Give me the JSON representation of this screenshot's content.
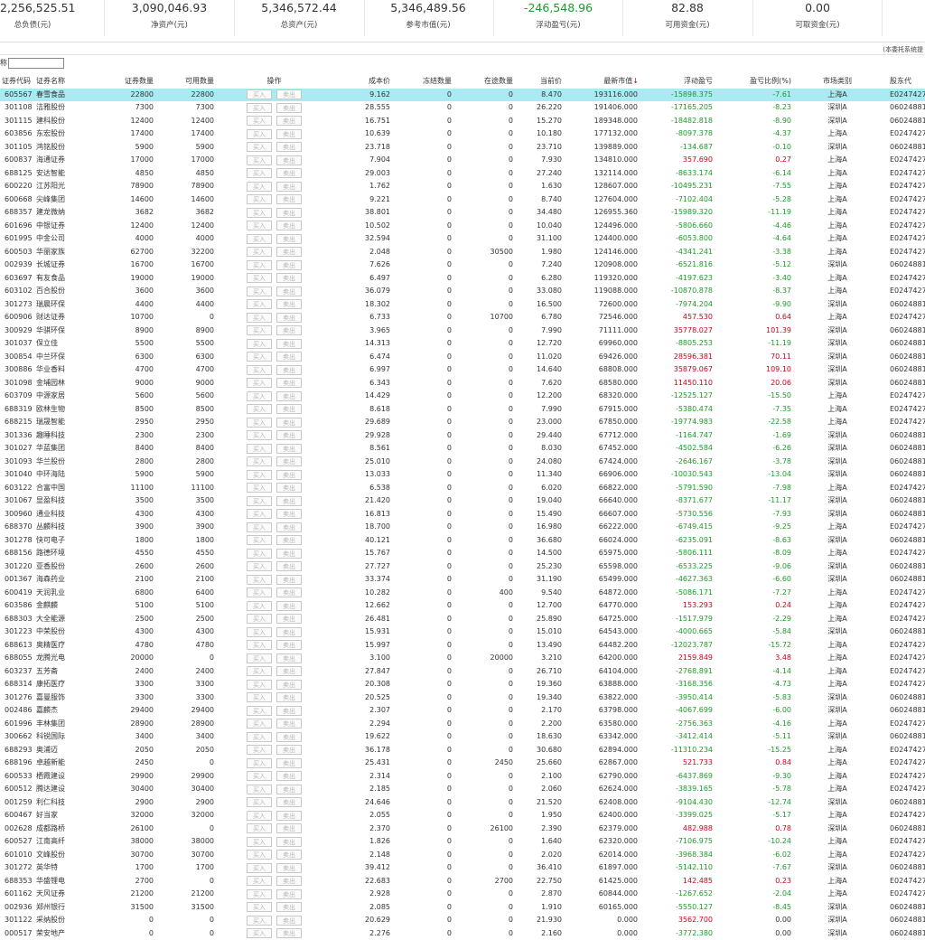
{
  "summary": [
    {
      "value": "2,256,525.51",
      "label": "总负债(元)"
    },
    {
      "value": "3,090,046.93",
      "label": "净资产(元)"
    },
    {
      "value": "5,346,572.44",
      "label": "总资产(元)"
    },
    {
      "value": "5,346,489.56",
      "label": "参考市值(元)"
    },
    {
      "value": "-246,548.96",
      "label": "浮动盈亏(元)",
      "color": "#1c9c28"
    },
    {
      "value": "82.88",
      "label": "可用资金(元)"
    },
    {
      "value": "0.00",
      "label": "可取资金(元)"
    }
  ],
  "note": "(本委托系统提",
  "filter_label": "称",
  "filter_value": "",
  "buy_label": "买入",
  "sell_label": "卖出",
  "sort_icon": "↓",
  "columns": [
    "证券代码",
    "证券名称",
    "证券数量",
    "可用数量",
    "操作",
    "成本价",
    "冻结数量",
    "在途数量",
    "当前价",
    "最新市值",
    "浮动盈亏",
    "盈亏比例(%)",
    "市场类别",
    "股东代"
  ],
  "rows": [
    [
      "605567",
      "春雪食品",
      "22800",
      "22800",
      "9.162",
      "0",
      "0",
      "8.470",
      "193116.000",
      "-15898.375",
      "-7.61",
      "上海A",
      "E0247427"
    ],
    [
      "301108",
      "洁雅股份",
      "7300",
      "7300",
      "28.555",
      "0",
      "0",
      "26.220",
      "191406.000",
      "-17165.205",
      "-8.23",
      "深圳A",
      "06024881"
    ],
    [
      "301115",
      "建科股份",
      "12400",
      "12400",
      "16.751",
      "0",
      "0",
      "15.270",
      "189348.000",
      "-18482.818",
      "-8.90",
      "深圳A",
      "06024881"
    ],
    [
      "603856",
      "东宏股份",
      "17400",
      "17400",
      "10.639",
      "0",
      "0",
      "10.180",
      "177132.000",
      "-8097.378",
      "-4.37",
      "上海A",
      "E0247427"
    ],
    [
      "301105",
      "鸿铭股份",
      "5900",
      "5900",
      "23.718",
      "0",
      "0",
      "23.710",
      "139889.000",
      "-134.687",
      "-0.10",
      "深圳A",
      "06024881"
    ],
    [
      "600837",
      "海通证券",
      "17000",
      "17000",
      "7.904",
      "0",
      "0",
      "7.930",
      "134810.000",
      "357.690",
      "0.27",
      "上海A",
      "E0247427"
    ],
    [
      "688125",
      "安达智能",
      "4850",
      "4850",
      "29.003",
      "0",
      "0",
      "27.240",
      "132114.000",
      "-8633.174",
      "-6.14",
      "上海A",
      "E0247427"
    ],
    [
      "600220",
      "江苏阳光",
      "78900",
      "78900",
      "1.762",
      "0",
      "0",
      "1.630",
      "128607.000",
      "-10495.231",
      "-7.55",
      "上海A",
      "E0247427"
    ],
    [
      "600668",
      "尖峰集团",
      "14600",
      "14600",
      "9.221",
      "0",
      "0",
      "8.740",
      "127604.000",
      "-7102.404",
      "-5.28",
      "上海A",
      "E0247427"
    ],
    [
      "688357",
      "建龙微纳",
      "3682",
      "3682",
      "38.801",
      "0",
      "0",
      "34.480",
      "126955.360",
      "-15989.320",
      "-11.19",
      "上海A",
      "E0247427"
    ],
    [
      "601696",
      "中银证券",
      "12400",
      "12400",
      "10.502",
      "0",
      "0",
      "10.040",
      "124496.000",
      "-5806.660",
      "-4.46",
      "上海A",
      "E0247427"
    ],
    [
      "601995",
      "中金公司",
      "4000",
      "4000",
      "32.594",
      "0",
      "0",
      "31.100",
      "124400.000",
      "-6053.800",
      "-4.64",
      "上海A",
      "E0247427"
    ],
    [
      "600503",
      "华丽家族",
      "62700",
      "32200",
      "2.048",
      "0",
      "30500",
      "1.980",
      "124146.000",
      "-4341.241",
      "-3.38",
      "上海A",
      "E0247427"
    ],
    [
      "002939",
      "长城证券",
      "16700",
      "16700",
      "7.626",
      "0",
      "0",
      "7.240",
      "120908.000",
      "-6521.816",
      "-5.12",
      "深圳A",
      "06024881"
    ],
    [
      "603697",
      "有友食品",
      "19000",
      "19000",
      "6.497",
      "0",
      "0",
      "6.280",
      "119320.000",
      "-4197.623",
      "-3.40",
      "上海A",
      "E0247427"
    ],
    [
      "603102",
      "百合股份",
      "3600",
      "3600",
      "36.079",
      "0",
      "0",
      "33.080",
      "119088.000",
      "-10870.878",
      "-8.37",
      "上海A",
      "E0247427"
    ],
    [
      "301273",
      "瑞晨环保",
      "4400",
      "4400",
      "18.302",
      "0",
      "0",
      "16.500",
      "72600.000",
      "-7974.204",
      "-9.90",
      "深圳A",
      "06024881"
    ],
    [
      "600906",
      "财达证券",
      "10700",
      "0",
      "6.733",
      "0",
      "10700",
      "6.780",
      "72546.000",
      "457.530",
      "0.64",
      "上海A",
      "E0247427"
    ],
    [
      "300929",
      "华骐环保",
      "8900",
      "8900",
      "3.965",
      "0",
      "0",
      "7.990",
      "71111.000",
      "35778.027",
      "101.39",
      "深圳A",
      "06024881"
    ],
    [
      "301037",
      "保立佳",
      "5500",
      "5500",
      "14.313",
      "0",
      "0",
      "12.720",
      "69960.000",
      "-8805.253",
      "-11.19",
      "深圳A",
      "06024881"
    ],
    [
      "300854",
      "中兰环保",
      "6300",
      "6300",
      "6.474",
      "0",
      "0",
      "11.020",
      "69426.000",
      "28596.381",
      "70.11",
      "深圳A",
      "06024881"
    ],
    [
      "300886",
      "华业香料",
      "4700",
      "4700",
      "6.997",
      "0",
      "0",
      "14.640",
      "68808.000",
      "35879.067",
      "109.10",
      "深圳A",
      "06024881"
    ],
    [
      "301098",
      "金埔园林",
      "9000",
      "9000",
      "6.343",
      "0",
      "0",
      "7.620",
      "68580.000",
      "11450.110",
      "20.06",
      "深圳A",
      "06024881"
    ],
    [
      "603709",
      "中源家居",
      "5600",
      "5600",
      "14.429",
      "0",
      "0",
      "12.200",
      "68320.000",
      "-12525.127",
      "-15.50",
      "上海A",
      "E0247427"
    ],
    [
      "688319",
      "欧林生物",
      "8500",
      "8500",
      "8.618",
      "0",
      "0",
      "7.990",
      "67915.000",
      "-5380.474",
      "-7.35",
      "上海A",
      "E0247427"
    ],
    [
      "688215",
      "瑞晟智能",
      "2950",
      "2950",
      "29.689",
      "0",
      "0",
      "23.000",
      "67850.000",
      "-19774.983",
      "-22.58",
      "上海A",
      "E0247427"
    ],
    [
      "301336",
      "趣睡科技",
      "2300",
      "2300",
      "29.928",
      "0",
      "0",
      "29.440",
      "67712.000",
      "-1164.747",
      "-1.69",
      "深圳A",
      "06024881"
    ],
    [
      "301027",
      "华蓝集团",
      "8400",
      "8400",
      "8.561",
      "0",
      "0",
      "8.030",
      "67452.000",
      "-4502.584",
      "-6.26",
      "深圳A",
      "06024881"
    ],
    [
      "301093",
      "华兰股份",
      "2800",
      "2800",
      "25.010",
      "0",
      "0",
      "24.080",
      "67424.000",
      "-2646.167",
      "-3.78",
      "深圳A",
      "06024881"
    ],
    [
      "301040",
      "中环海陆",
      "5900",
      "5900",
      "13.033",
      "0",
      "0",
      "11.340",
      "66906.000",
      "-10030.543",
      "-13.04",
      "深圳A",
      "06024881"
    ],
    [
      "603122",
      "合富中国",
      "11100",
      "11100",
      "6.538",
      "0",
      "0",
      "6.020",
      "66822.000",
      "-5791.590",
      "-7.98",
      "上海A",
      "E0247427"
    ],
    [
      "301067",
      "显盈科技",
      "3500",
      "3500",
      "21.420",
      "0",
      "0",
      "19.040",
      "66640.000",
      "-8371.677",
      "-11.17",
      "深圳A",
      "06024881"
    ],
    [
      "300960",
      "通业科技",
      "4300",
      "4300",
      "16.813",
      "0",
      "0",
      "15.490",
      "66607.000",
      "-5730.556",
      "-7.93",
      "深圳A",
      "06024881"
    ],
    [
      "688370",
      "丛麟科技",
      "3900",
      "3900",
      "18.700",
      "0",
      "0",
      "16.980",
      "66222.000",
      "-6749.415",
      "-9.25",
      "上海A",
      "E0247427"
    ],
    [
      "301278",
      "快可电子",
      "1800",
      "1800",
      "40.121",
      "0",
      "0",
      "36.680",
      "66024.000",
      "-6235.091",
      "-8.63",
      "深圳A",
      "06024881"
    ],
    [
      "688156",
      "路德环境",
      "4550",
      "4550",
      "15.767",
      "0",
      "0",
      "14.500",
      "65975.000",
      "-5806.111",
      "-8.09",
      "上海A",
      "E0247427"
    ],
    [
      "301220",
      "亚香股份",
      "2600",
      "2600",
      "27.727",
      "0",
      "0",
      "25.230",
      "65598.000",
      "-6533.225",
      "-9.06",
      "深圳A",
      "06024881"
    ],
    [
      "001367",
      "海森药业",
      "2100",
      "2100",
      "33.374",
      "0",
      "0",
      "31.190",
      "65499.000",
      "-4627.363",
      "-6.60",
      "深圳A",
      "06024881"
    ],
    [
      "600419",
      "天润乳业",
      "6800",
      "6400",
      "10.282",
      "0",
      "400",
      "9.540",
      "64872.000",
      "-5086.171",
      "-7.27",
      "上海A",
      "E0247427"
    ],
    [
      "603586",
      "金麒麟",
      "5100",
      "5100",
      "12.662",
      "0",
      "0",
      "12.700",
      "64770.000",
      "153.293",
      "0.24",
      "上海A",
      "E0247427"
    ],
    [
      "688303",
      "大全能源",
      "2500",
      "2500",
      "26.481",
      "0",
      "0",
      "25.890",
      "64725.000",
      "-1517.979",
      "-2.29",
      "上海A",
      "E0247427"
    ],
    [
      "301223",
      "中荣股份",
      "4300",
      "4300",
      "15.931",
      "0",
      "0",
      "15.010",
      "64543.000",
      "-4000.665",
      "-5.84",
      "深圳A",
      "06024881"
    ],
    [
      "688613",
      "奥精医疗",
      "4780",
      "4780",
      "15.997",
      "0",
      "0",
      "13.490",
      "64482.200",
      "-12023.787",
      "-15.72",
      "上海A",
      "E0247427"
    ],
    [
      "688055",
      "龙腾光电",
      "20000",
      "0",
      "3.100",
      "0",
      "20000",
      "3.210",
      "64200.000",
      "2159.849",
      "3.48",
      "上海A",
      "E0247427"
    ],
    [
      "603237",
      "五芳斋",
      "2400",
      "2400",
      "27.847",
      "0",
      "0",
      "26.710",
      "64104.000",
      "-2768.891",
      "-4.14",
      "上海A",
      "E0247427"
    ],
    [
      "688314",
      "康拓医疗",
      "3300",
      "3300",
      "20.308",
      "0",
      "0",
      "19.360",
      "63888.000",
      "-3168.356",
      "-4.73",
      "上海A",
      "E0247427"
    ],
    [
      "301276",
      "嘉曼服饰",
      "3300",
      "3300",
      "20.525",
      "0",
      "0",
      "19.340",
      "63822.000",
      "-3950.414",
      "-5.83",
      "深圳A",
      "06024881"
    ],
    [
      "002486",
      "嘉麟杰",
      "29400",
      "29400",
      "2.307",
      "0",
      "0",
      "2.170",
      "63798.000",
      "-4067.699",
      "-6.00",
      "深圳A",
      "06024881"
    ],
    [
      "601996",
      "丰林集团",
      "28900",
      "28900",
      "2.294",
      "0",
      "0",
      "2.200",
      "63580.000",
      "-2756.363",
      "-4.16",
      "上海A",
      "E0247427"
    ],
    [
      "300662",
      "科锐国际",
      "3400",
      "3400",
      "19.622",
      "0",
      "0",
      "18.630",
      "63342.000",
      "-3412.414",
      "-5.11",
      "深圳A",
      "06024881"
    ],
    [
      "688293",
      "奥浦迈",
      "2050",
      "2050",
      "36.178",
      "0",
      "0",
      "30.680",
      "62894.000",
      "-11310.234",
      "-15.25",
      "上海A",
      "E0247427"
    ],
    [
      "688196",
      "卓越新能",
      "2450",
      "0",
      "25.431",
      "0",
      "2450",
      "25.660",
      "62867.000",
      "521.733",
      "0.84",
      "上海A",
      "E0247427"
    ],
    [
      "600533",
      "栖霞建设",
      "29900",
      "29900",
      "2.314",
      "0",
      "0",
      "2.100",
      "62790.000",
      "-6437.869",
      "-9.30",
      "上海A",
      "E0247427"
    ],
    [
      "600512",
      "腾达建设",
      "30400",
      "30400",
      "2.185",
      "0",
      "0",
      "2.060",
      "62624.000",
      "-3839.165",
      "-5.78",
      "上海A",
      "E0247427"
    ],
    [
      "001259",
      "利仁科技",
      "2900",
      "2900",
      "24.646",
      "0",
      "0",
      "21.520",
      "62408.000",
      "-9104.430",
      "-12.74",
      "深圳A",
      "06024881"
    ],
    [
      "600467",
      "好当家",
      "32000",
      "32000",
      "2.055",
      "0",
      "0",
      "1.950",
      "62400.000",
      "-3399.025",
      "-5.17",
      "上海A",
      "E0247427"
    ],
    [
      "002628",
      "成都路桥",
      "26100",
      "0",
      "2.370",
      "0",
      "26100",
      "2.390",
      "62379.000",
      "482.988",
      "0.78",
      "深圳A",
      "06024881"
    ],
    [
      "600527",
      "江南高纤",
      "38000",
      "38000",
      "1.826",
      "0",
      "0",
      "1.640",
      "62320.000",
      "-7106.975",
      "-10.24",
      "上海A",
      "E0247427"
    ],
    [
      "601010",
      "文峰股份",
      "30700",
      "30700",
      "2.148",
      "0",
      "0",
      "2.020",
      "62014.000",
      "-3968.384",
      "-6.02",
      "上海A",
      "E0247427"
    ],
    [
      "301272",
      "英华特",
      "1700",
      "1700",
      "39.412",
      "0",
      "0",
      "36.410",
      "61897.000",
      "-5142.110",
      "-7.67",
      "深圳A",
      "06024881"
    ],
    [
      "688353",
      "华盛锂电",
      "2700",
      "0",
      "22.683",
      "0",
      "2700",
      "22.750",
      "61425.000",
      "142.485",
      "0.23",
      "上海A",
      "E0247427"
    ],
    [
      "601162",
      "天风证券",
      "21200",
      "21200",
      "2.928",
      "0",
      "0",
      "2.870",
      "60844.000",
      "-1267.652",
      "-2.04",
      "上海A",
      "E0247427"
    ],
    [
      "002936",
      "郑州银行",
      "31500",
      "31500",
      "2.085",
      "0",
      "0",
      "1.910",
      "60165.000",
      "-5550.127",
      "-8.45",
      "深圳A",
      "06024881"
    ],
    [
      "301122",
      "采纳股份",
      "0",
      "0",
      "20.629",
      "0",
      "0",
      "21.930",
      "0.000",
      "3562.700",
      "0.00",
      "深圳A",
      "06024881"
    ],
    [
      "000517",
      "荣安地产",
      "0",
      "0",
      "2.276",
      "0",
      "0",
      "2.160",
      "0.000",
      "-3772.380",
      "0.00",
      "深圳A",
      "06024881"
    ]
  ]
}
